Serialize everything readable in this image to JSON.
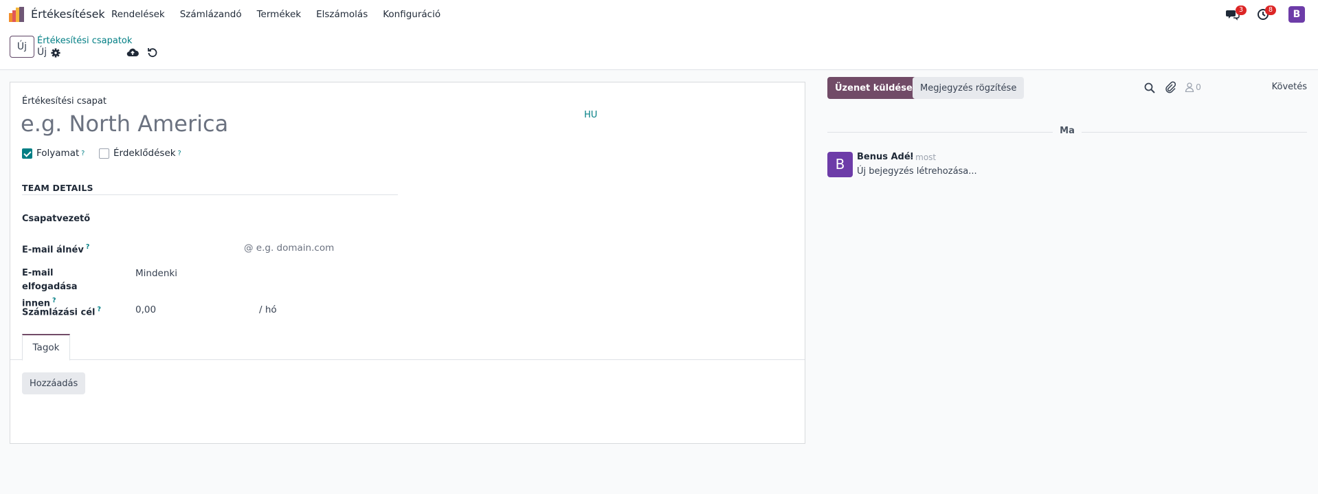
{
  "navbar": {
    "app_name": "Értékesítések",
    "menu": [
      "Rendelések",
      "Számlázandó",
      "Termékek",
      "Elszámolás",
      "Konfiguráció"
    ],
    "messages_badge": "3",
    "activities_badge": "8",
    "user_initial": "B"
  },
  "control": {
    "new_label": "Új",
    "breadcrumb_parent": "Értékesítési csapatok",
    "breadcrumb_current": "Új"
  },
  "form": {
    "name_label": "Értékesítési csapat",
    "name_placeholder": "e.g. North America",
    "lang": "HU",
    "checkboxes": [
      {
        "label": "Folyamat",
        "help": "?",
        "checked": true
      },
      {
        "label": "Érdeklődések",
        "help": "?",
        "checked": false
      }
    ],
    "section_title": "TEAM DETAILS",
    "team_leader_label": "Csapatvezető",
    "email_alias_label": "E-mail álnév",
    "email_alias_help": "?",
    "email_alias_placeholder": "@ e.g. domain.com",
    "accept_from_label": "E-mail elfogadása innen",
    "accept_from_help": "?",
    "accept_from_value": "Mindenki",
    "invoice_target_label": "Számlázási cél",
    "invoice_target_help": "?",
    "invoice_target_value": "0,00",
    "invoice_target_unit": "/ hó",
    "tabs": [
      "Tagok"
    ],
    "add_button": "Hozzáadás"
  },
  "chatter": {
    "send_message": "Üzenet küldése",
    "log_note": "Megjegyzés rögzítése",
    "followers_count": "0",
    "follow": "Követés",
    "date_separator": "Ma",
    "messages": [
      {
        "initial": "B",
        "author": "Benus Adél",
        "time": "- most",
        "body": "Új bejegyzés létrehozása..."
      }
    ]
  },
  "colors": {
    "brand": "#714b67",
    "link": "#017e84",
    "badge": "#dc2626",
    "avatar": "#6d3ca8"
  }
}
